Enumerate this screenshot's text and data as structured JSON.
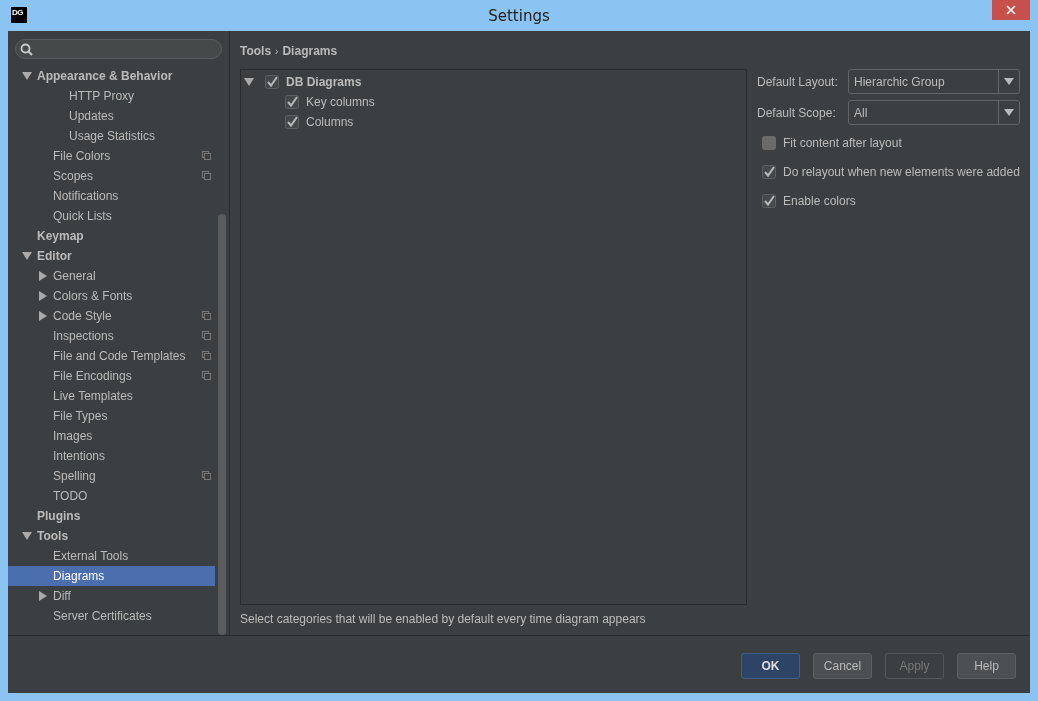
{
  "window": {
    "logo": "DG",
    "title": "Settings"
  },
  "sidebar": {
    "items": [
      {
        "label": "Appearance & Behavior",
        "expanded": true,
        "selected": false,
        "children": [
          {
            "children": [
              {
                "label": "HTTP Proxy",
                "selected": false
              },
              {
                "label": "Updates",
                "selected": false
              },
              {
                "label": "Usage Statistics",
                "selected": false
              }
            ]
          },
          {
            "label": "File Colors",
            "selected": false,
            "copy_icon": true
          },
          {
            "label": "Scopes",
            "selected": false,
            "copy_icon": true
          },
          {
            "label": "Notifications",
            "selected": false
          },
          {
            "label": "Quick Lists",
            "selected": false
          }
        ]
      },
      {
        "label": "Keymap",
        "selected": false
      },
      {
        "label": "Editor",
        "expanded": true,
        "selected": false,
        "children": [
          {
            "label": "General",
            "expanded": false,
            "selected": false
          },
          {
            "label": "Colors & Fonts",
            "expanded": false,
            "selected": false
          },
          {
            "label": "Code Style",
            "expanded": false,
            "selected": false,
            "copy_icon": true
          },
          {
            "label": "Inspections",
            "selected": false,
            "copy_icon": true
          },
          {
            "label": "File and Code Templates",
            "selected": false,
            "copy_icon": true
          },
          {
            "label": "File Encodings",
            "selected": false,
            "copy_icon": true
          },
          {
            "label": "Live Templates",
            "selected": false
          },
          {
            "label": "File Types",
            "selected": false
          },
          {
            "label": "Images",
            "selected": false
          },
          {
            "label": "Intentions",
            "selected": false
          },
          {
            "label": "Spelling",
            "selected": false,
            "copy_icon": true
          },
          {
            "label": "TODO",
            "selected": false
          }
        ]
      },
      {
        "label": "Plugins",
        "selected": false
      },
      {
        "label": "Tools",
        "expanded": true,
        "selected": false,
        "children": [
          {
            "label": "External Tools",
            "selected": false
          },
          {
            "label": "Diagrams",
            "selected": true
          },
          {
            "label": "Diff",
            "expanded": false,
            "selected": false
          },
          {
            "label": "Server Certificates",
            "selected": false
          }
        ]
      }
    ]
  },
  "breadcrumb": [
    "Tools",
    "›",
    "Diagrams"
  ],
  "categories": [
    {
      "label": "DB Diagrams",
      "checked": true,
      "expanded": true,
      "children": [
        {
          "label": "Key columns",
          "checked": true
        },
        {
          "label": "Columns",
          "checked": true
        }
      ]
    }
  ],
  "hint": "Select categories that will be enabled by default every time diagram appears",
  "options": {
    "fields": [
      {
        "label": "Default Layout:",
        "value": "Hierarchic Group"
      },
      {
        "label": "Default Scope:",
        "value": "All"
      }
    ],
    "checkboxes": [
      {
        "label": "Fit content after layout",
        "checked": false
      },
      {
        "label": "Do relayout when new elements were added",
        "checked": true
      },
      {
        "label": "Enable colors",
        "checked": true
      }
    ]
  },
  "buttons": [
    {
      "label": "OK",
      "kind": "default"
    },
    {
      "label": "Cancel",
      "kind": "normal"
    },
    {
      "label": "Apply",
      "kind": "disabled"
    },
    {
      "label": "Help",
      "kind": "normal"
    }
  ]
}
